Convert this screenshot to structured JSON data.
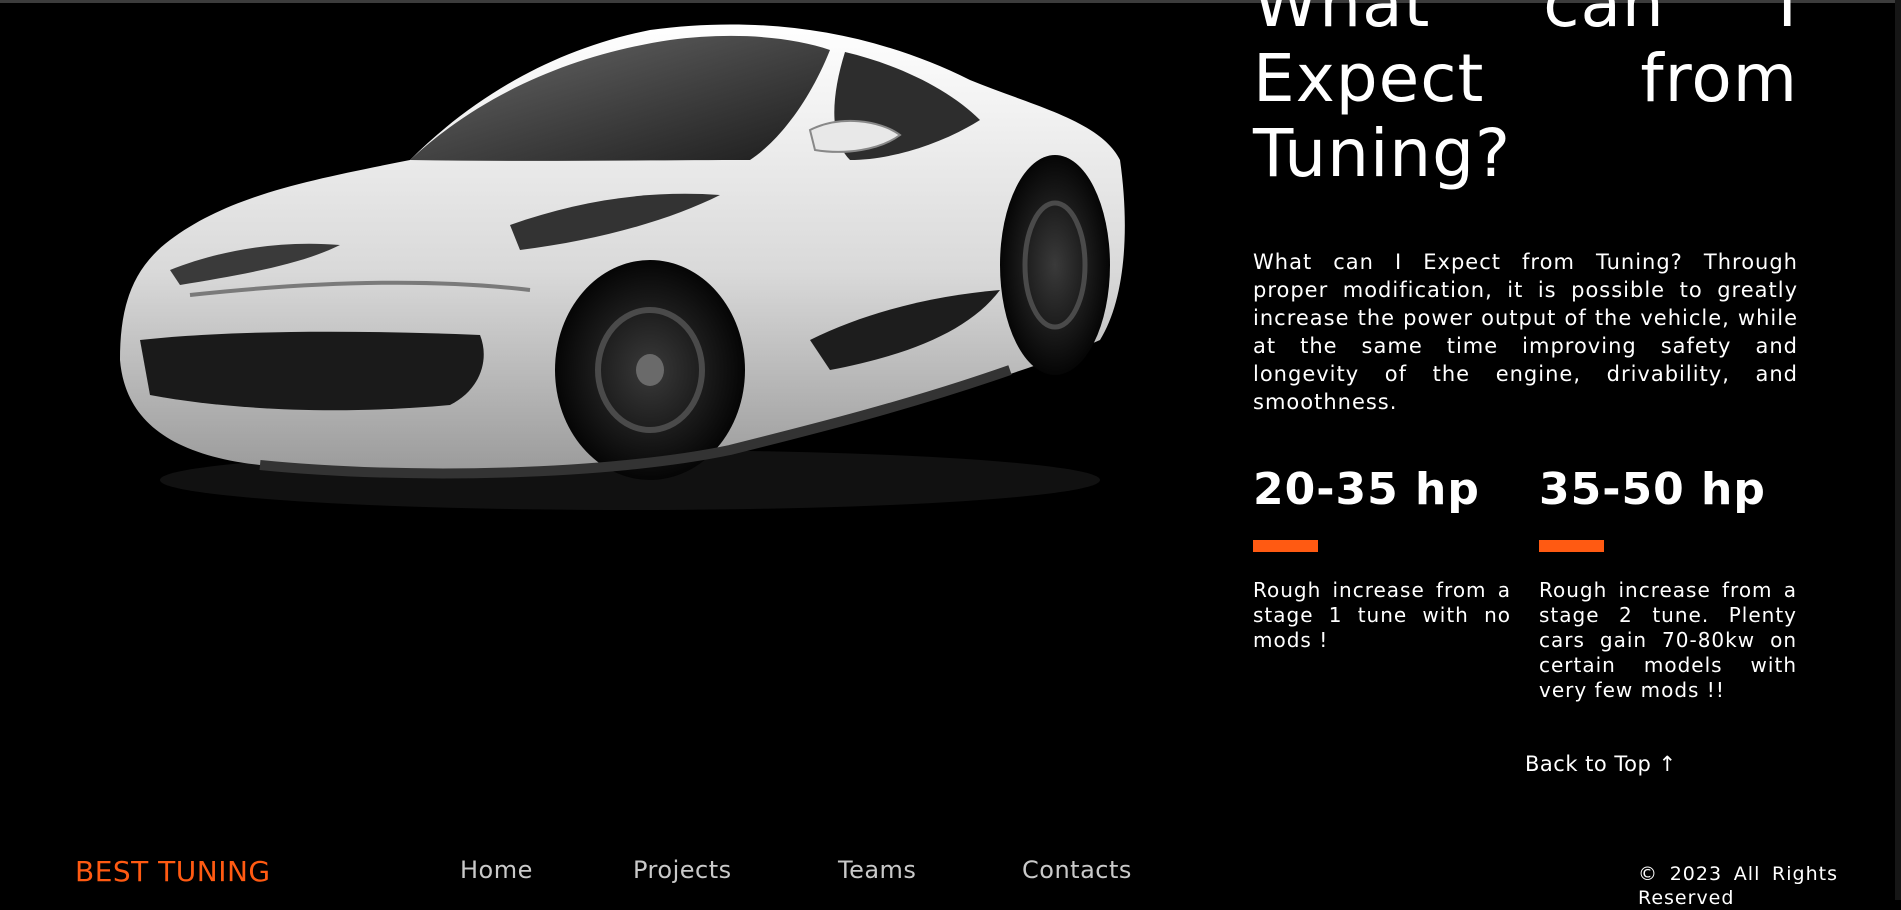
{
  "car_image": {
    "alt": "white sports car",
    "colors": {
      "body": "#e6e6e6",
      "shadow": "#5a5a5a",
      "glass": "#2a2a2a"
    }
  },
  "section": {
    "heading": "What can I Expect from Tuning?",
    "intro": "What can I Expect from Tuning? Through proper modification, it is possible to greatly increase the power output of the vehicle, while at the same time improving safety and longevity of the engine, drivability, and smoothness."
  },
  "stats": [
    {
      "value": "20-35 hp",
      "description": "Rough increase from a stage 1 tune with no mods !"
    },
    {
      "value": "35-50 hp",
      "description": "Rough increase from a stage 2 tune. Plenty cars gain 70-80kw on certain models with very few mods !!"
    }
  ],
  "back_to_top": "Back to Top ↑",
  "footer": {
    "brand": "BEST TUNING",
    "nav": [
      "Home",
      "Projects",
      "Teams",
      "Contacts"
    ],
    "copyright": "© 2023 All Rights Reserved"
  },
  "colors": {
    "accent": "#ff5a12",
    "background": "#000000",
    "text": "#ffffff",
    "nav_text": "#c9c9c9"
  }
}
